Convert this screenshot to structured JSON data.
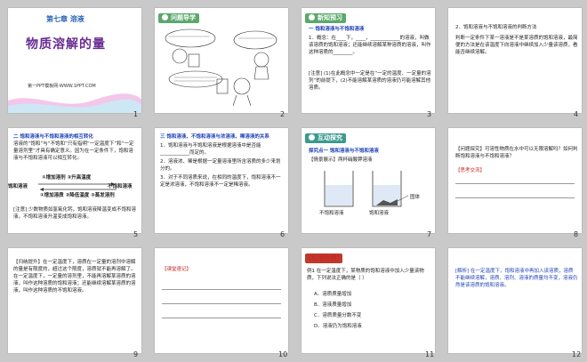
{
  "slides": [
    {
      "num": "1",
      "chapter": "第七章  溶液",
      "title": "物质溶解的量",
      "footer": "第一PPT模板网-WWW.1PPT.COM"
    },
    {
      "num": "2",
      "header": "问题导学"
    },
    {
      "num": "3",
      "header": "新知预习",
      "section": "一  饱和溶液与不饱和溶液",
      "lines": [
        "1．概念：在____下，____，____________的溶液，叫做该溶质的饱和溶液；还能继续溶解某种溶质的溶液，叫作这种溶质的________。",
        "[注意] (1)在此概念中一定是在“一定的温度、一定量的溶剂”的前提下，(2)不能溶解某溶质的溶液仍可能溶解其他溶质。"
      ]
    },
    {
      "num": "4",
      "lines": [
        "2．饱和溶液与不饱和溶液的判断方法",
        "判断一定条件下某一溶液是不是某溶质的饱和溶液，最简便的方法是在该温度下向溶液中继续加入少量该溶质，看能否继续溶解。"
      ]
    },
    {
      "num": "5",
      "section": "二  饱和溶液与不饱和溶液的相互转化",
      "lines": [
        "溶液的“饱和”与“不饱和”只有指明“一定温度下”和“一定量溶剂里”才具有确定意义。因为在一定条件下，饱和溶液与不饱和溶液可以相互转化。"
      ],
      "left": "饱和溶液",
      "right": "不饱和溶液",
      "up": "①增加溶剂 ②升高温度",
      "down": "①增加溶质 ②降低温度 ③蒸发溶剂",
      "note": "[注意] 少数物质如氢氧化钙，饱和溶液降温变成不饱和溶液，不饱和溶液升温变成饱和溶液。"
    },
    {
      "num": "6",
      "section": "三  饱和溶液、不饱和溶液与浓溶液、稀溶液的关系",
      "lines": [
        "1．饱和溶液与不饱和溶液是根据溶液中是否能____________而定的。",
        "2．溶液浓、稀是根据一定量溶液里所含溶质的多少来划分的。",
        "3．对于不同溶质来说，在相同的温度下，饱和溶液不一定是浓溶液，不饱和溶液不一定是稀溶液。"
      ]
    },
    {
      "num": "7",
      "header": "互动探究",
      "section": "探究点一  饱和溶液与不饱和溶液",
      "q": "【情景展示】两杯硝酸钾溶液",
      "labels": [
        "不饱和溶液",
        "饱和溶液",
        "固体"
      ]
    },
    {
      "num": "8",
      "q": "【问题探究】可溶性物质在水中可以无限溶解吗？如何判断饱和溶液与不饱和溶液？",
      "a": "【思考交流】"
    },
    {
      "num": "9",
      "lines": [
        "【归纳提升】在一定温度下，溶质在一定量的溶剂中溶解的量是有限度的，超过这个限度，溶质就不能再溶解了。在一定温度下，一定量的溶剂里，不能再溶解某溶质的溶液，叫作这种溶质的饱和溶液；还能继续溶解某溶质的溶液，叫作这种溶质的不饱和溶液。"
      ]
    },
    {
      "num": "10",
      "a": "【课堂速记】"
    },
    {
      "num": "11",
      "header": "[应用示例]",
      "lines": [
        "例1  在一定温度下，某物质的饱和溶液中加入少量该物质，下列说法正确的是（  ）",
        "A．溶质质量增加",
        "B．溶液质量增加",
        "C．溶质质量分数不变",
        "D．溶液仍为饱和溶液"
      ]
    },
    {
      "num": "12",
      "lines": [
        "[解析] 在一定温度下，饱和溶液中再加入该溶质，溶质不能继续溶解，溶质、溶剂、溶液的质量均不变，溶液仍然是该溶质的饱和溶液。"
      ]
    }
  ],
  "colors": {
    "accent_blue": "#1c3fb8",
    "accent_red": "#c62828",
    "wave": "#e8a3d8",
    "wave2": "#9ad0ea",
    "title_purple": "#6a2c91"
  }
}
